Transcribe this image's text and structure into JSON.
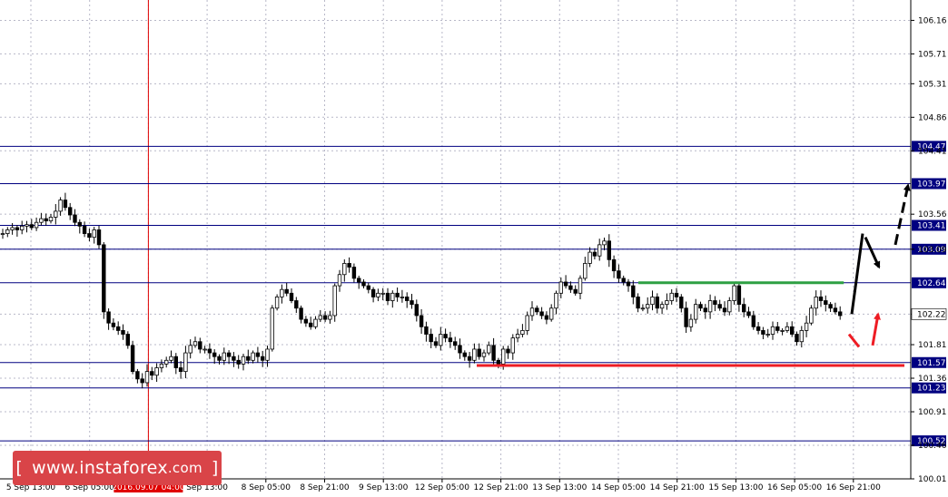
{
  "chart_data": {
    "type": "candlestick",
    "symbol_hint": "USDJPY H4",
    "y_axis": {
      "ylim": [
        100.01,
        106.36
      ],
      "tick_labels": [
        "106.16",
        "105.71",
        "105.31",
        "104.86",
        "104.41",
        "103.56",
        "103.09",
        "102.22",
        "101.81",
        "101.36",
        "100.91",
        "100.46",
        "100.01"
      ],
      "tick_values": [
        106.16,
        105.71,
        105.31,
        104.86,
        104.41,
        103.56,
        103.09,
        102.22,
        101.81,
        101.36,
        100.91,
        100.46,
        100.01
      ]
    },
    "x_axis": {
      "tick_labels": [
        "5 Sep 13:00",
        "6 Sep 05:00",
        "2016.09.07 04:00",
        "Sep 13:00",
        "8 Sep 05:00",
        "8 Sep 21:00",
        "9 Sep 13:00",
        "12 Sep 05:00",
        "12 Sep 21:00",
        "13 Sep 13:00",
        "14 Sep 05:00",
        "14 Sep 21:00",
        "15 Sep 13:00",
        "16 Sep 05:00",
        "16 Sep 21:00"
      ],
      "highlighted_label": "2016.09.07 04:00"
    },
    "levels": [
      {
        "value": 104.47,
        "label": "104.47"
      },
      {
        "value": 103.97,
        "label": "103.97"
      },
      {
        "value": 103.41,
        "label": "103.41"
      },
      {
        "value": 103.09,
        "label": "103.09"
      },
      {
        "value": 102.64,
        "label": "102.64"
      },
      {
        "value": 101.57,
        "label": "101.57"
      },
      {
        "value": 101.23,
        "label": "101.23"
      },
      {
        "value": 100.52,
        "label": "100.52"
      }
    ],
    "current_price": {
      "value": 102.22,
      "label": "102.22"
    },
    "resistance_line": {
      "value": 102.64,
      "color": "#2ea043"
    },
    "support_line": {
      "value": 101.53,
      "color": "#ee1c24"
    },
    "closes": [
      103.3,
      103.35,
      103.38,
      103.35,
      103.4,
      103.42,
      103.38,
      103.45,
      103.5,
      103.47,
      103.52,
      103.6,
      103.75,
      103.65,
      103.55,
      103.45,
      103.4,
      103.3,
      103.25,
      103.35,
      103.15,
      102.25,
      102.1,
      102.05,
      102.0,
      101.95,
      101.8,
      101.45,
      101.35,
      101.3,
      101.45,
      101.4,
      101.5,
      101.55,
      101.6,
      101.65,
      101.5,
      101.45,
      101.7,
      101.8,
      101.85,
      101.75,
      101.75,
      101.7,
      101.65,
      101.6,
      101.7,
      101.65,
      101.6,
      101.55,
      101.65,
      101.6,
      101.7,
      101.65,
      101.6,
      101.75,
      102.3,
      102.45,
      102.55,
      102.5,
      102.4,
      102.3,
      102.15,
      102.1,
      102.05,
      102.15,
      102.2,
      102.15,
      102.2,
      102.6,
      102.75,
      102.9,
      102.85,
      102.7,
      102.65,
      102.6,
      102.55,
      102.45,
      102.5,
      102.5,
      102.4,
      102.5,
      102.45,
      102.45,
      102.4,
      102.35,
      102.2,
      102.05,
      101.95,
      101.85,
      101.8,
      101.95,
      101.9,
      101.85,
      101.8,
      101.7,
      101.65,
      101.6,
      101.75,
      101.65,
      101.7,
      101.8,
      101.6,
      101.55,
      101.75,
      101.7,
      101.9,
      101.95,
      102.0,
      102.2,
      102.3,
      102.25,
      102.2,
      102.15,
      102.3,
      102.5,
      102.65,
      102.6,
      102.55,
      102.5,
      102.7,
      102.9,
      103.05,
      103.0,
      103.15,
      103.2,
      102.95,
      102.8,
      102.7,
      102.65,
      102.6,
      102.45,
      102.3,
      102.3,
      102.35,
      102.45,
      102.3,
      102.35,
      102.4,
      102.5,
      102.45,
      102.3,
      102.05,
      102.15,
      102.35,
      102.3,
      102.25,
      102.4,
      102.35,
      102.3,
      102.25,
      102.4,
      102.6,
      102.35,
      102.25,
      102.2,
      102.05,
      102.0,
      101.95,
      101.95,
      102.05,
      102.0,
      102.0,
      102.05,
      101.95,
      101.85,
      102.0,
      102.1,
      102.3,
      102.45,
      102.4,
      102.35,
      102.3,
      102.25,
      102.2
    ]
  },
  "projection_arrows": [
    {
      "color": "#000000",
      "style": "solid",
      "meaning": "up-move"
    },
    {
      "color": "#000000",
      "style": "solid",
      "meaning": "pullback"
    },
    {
      "color": "#000000",
      "style": "dashed",
      "meaning": "continuation-up"
    },
    {
      "color": "#ee1c24",
      "style": "solid",
      "meaning": "dip"
    },
    {
      "color": "#ee1c24",
      "style": "solid",
      "meaning": "rebound"
    }
  ],
  "colors": {
    "grid": "#b8b8c8",
    "level_line": "#000080",
    "level_label_bg": "#000080",
    "price_label_bg": "#ffffff",
    "time_marker": "#e00000",
    "candle": "#000000",
    "watermark_bg": "#d94448"
  },
  "watermark": {
    "open": "[",
    "text": "www.instaforex",
    "suffix": ".com",
    "close": "]"
  }
}
